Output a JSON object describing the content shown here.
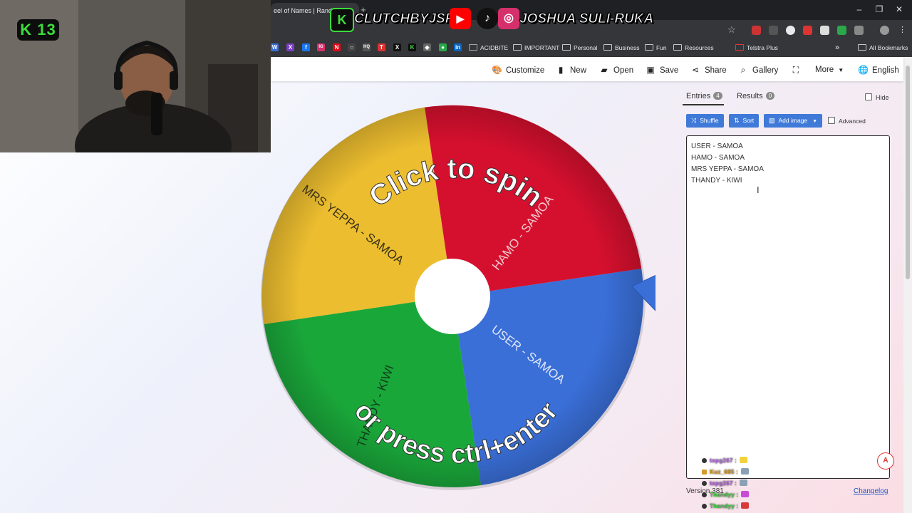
{
  "browser": {
    "tab_title": "eel of Names | Random",
    "new_tab": "+",
    "window_controls": [
      "–",
      "❐",
      "✕"
    ],
    "bookmarks": [
      "ACIDBITE",
      "IMPORTANT",
      "Personal",
      "Business",
      "Fun",
      "Resources",
      "Telstra Plus"
    ],
    "bookmarks_overflow": "»",
    "all_bookmarks": "All Bookmarks",
    "bookmark_icon_letters": [
      "W",
      "X",
      "f",
      "IG",
      "N",
      "○",
      "HQ",
      "T",
      "X",
      "K",
      "◆",
      "●",
      "in"
    ]
  },
  "toolbar": {
    "customize": "Customize",
    "new": "New",
    "open": "Open",
    "save": "Save",
    "share": "Share",
    "gallery": "Gallery",
    "fullscreen_icon": "⛶",
    "more": "More",
    "language": "English"
  },
  "wheel": {
    "prompt_top": "Click to spin",
    "prompt_bottom": "or press ctrl+enter",
    "segments": [
      {
        "label": "USER - SAMOA",
        "color": "#3a6fd8"
      },
      {
        "label": "HAMO - SAMOA",
        "color": "#d5102e"
      },
      {
        "label": "MRS YEPPA - SAMOA",
        "color": "#ecbd2f"
      },
      {
        "label": "THANDY - KIWI",
        "color": "#1aa73a"
      }
    ]
  },
  "panel": {
    "tab_entries": "Entries",
    "entries_count": "4",
    "tab_results": "Results",
    "results_count": "0",
    "hide": "Hide",
    "shuffle": "Shuffle",
    "sort": "Sort",
    "add_image": "Add image",
    "advanced": "Advanced",
    "entries": [
      "USER - SAMOA",
      "HAMO - SAMOA",
      "MRS YEPPA - SAMOA",
      "THANDY - KIWI"
    ],
    "version": "Version 381",
    "changelog": "Changelog",
    "pdf_label": "A"
  },
  "chat": [
    {
      "user": "topg267 :",
      "color": "#b06ad8"
    },
    {
      "user": "Kuz_685 :",
      "color": "#d49b2a"
    },
    {
      "user": "topg267 :",
      "color": "#b06ad8"
    },
    {
      "user": "Thandyy :",
      "color": "#3fce3f"
    },
    {
      "user": "Thandyy :",
      "color": "#3fce3f"
    }
  ],
  "stream": {
    "badge": "K 13",
    "logo_letter": "K",
    "channel_name": "CLUTCHBYJSR",
    "display_name": "JOSHUA SULI-RUKA",
    "youtube_icon": "▶",
    "tiktok_icon": "♪",
    "instagram_icon": "◎"
  }
}
